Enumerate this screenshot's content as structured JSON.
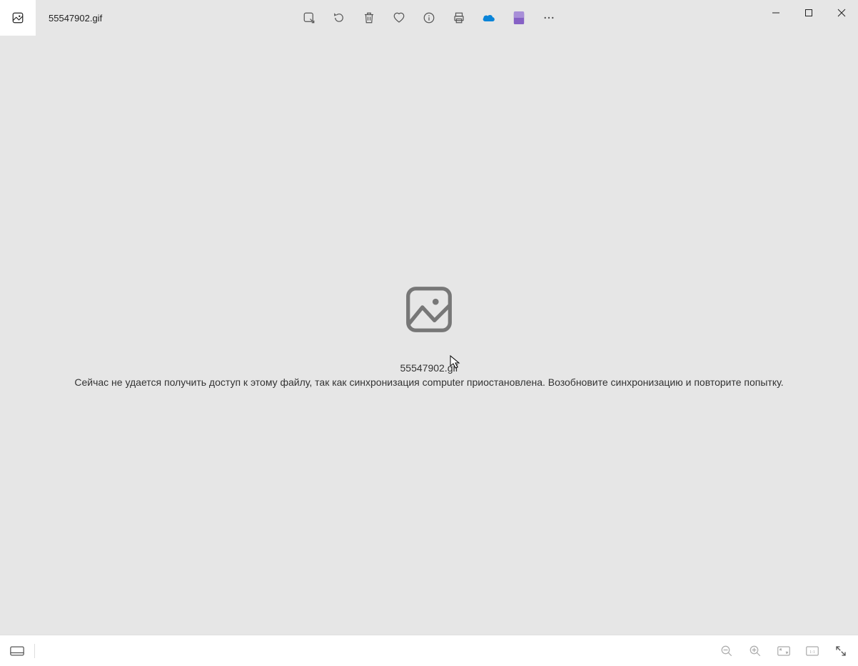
{
  "title": {
    "filename": "55547902.gif"
  },
  "toolbar": {
    "edit": "edit",
    "rotate": "rotate",
    "delete": "delete",
    "favorite": "favorite",
    "info": "info",
    "print": "print",
    "onedrive": "onedrive",
    "clipchamp": "clipchamp",
    "more": "more"
  },
  "window": {
    "minimize": "minimize",
    "maximize": "maximize",
    "close": "close"
  },
  "error": {
    "filename": "55547902.gif",
    "message": "Сейчас не удается получить доступ к этому файлу, так как синхронизация computer приостановлена.  Возобновите синхронизацию и повторите попытку."
  },
  "bottombar": {
    "filmstrip": "filmstrip",
    "zoomout": "zoom-out",
    "zoomin": "zoom-in",
    "fit": "fit",
    "actual": "actual",
    "fullscreen": "fullscreen"
  }
}
